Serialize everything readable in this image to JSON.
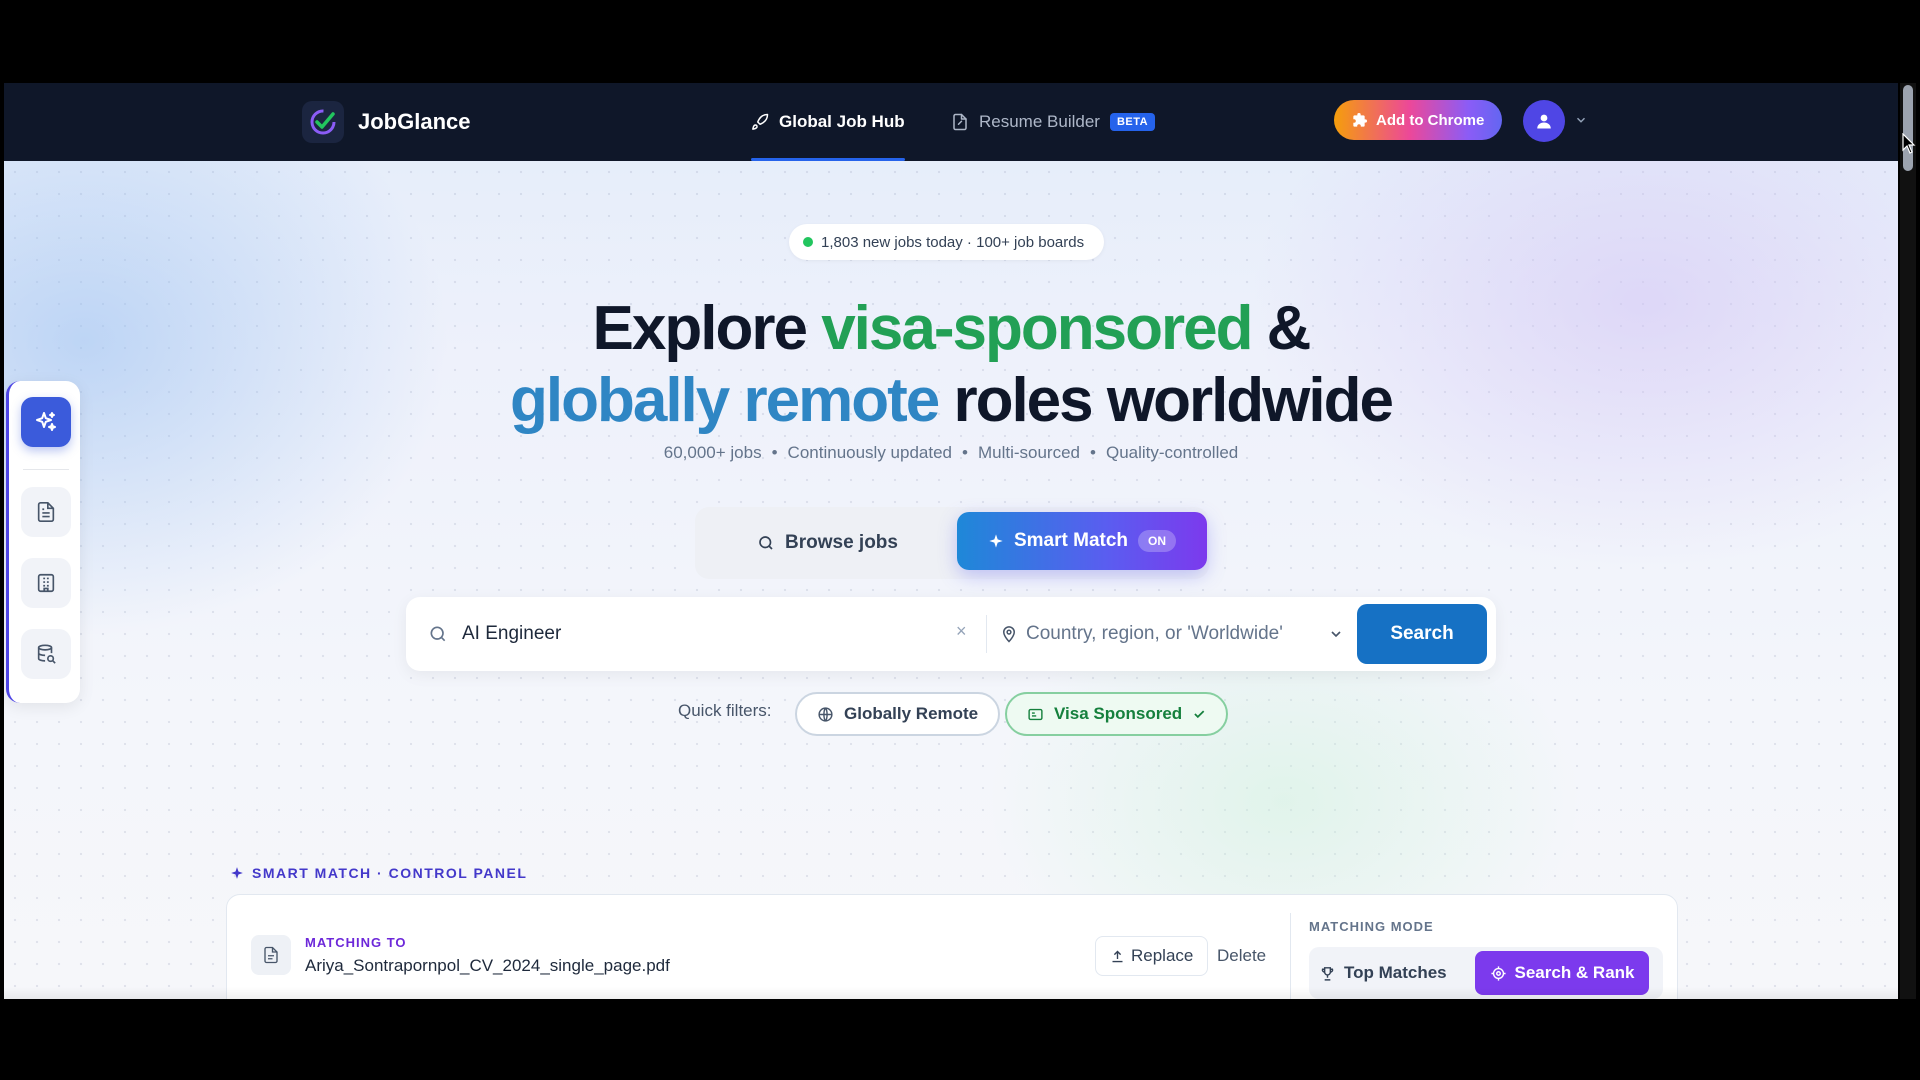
{
  "header": {
    "brand": "JobGlance",
    "tabs": [
      {
        "label": "Global Job Hub",
        "active": true
      },
      {
        "label": "Resume Builder",
        "badge": "BETA",
        "active": false
      }
    ],
    "cta_label": "Add to Chrome"
  },
  "sidebar": {
    "items": [
      {
        "icon": "sparkles-icon",
        "active": true
      },
      {
        "icon": "document-icon"
      },
      {
        "icon": "building-icon"
      },
      {
        "icon": "database-search-icon"
      }
    ]
  },
  "hero": {
    "badge": "1,803 new jobs today · 100+ job boards",
    "headline_line1_a": "Explore ",
    "headline_line1_b": "visa-sponsored",
    "headline_line1_c": " &",
    "headline_line2_a": "globally remote",
    "headline_line2_b": " roles worldwide",
    "subline": [
      "60,000+ jobs",
      "Continuously updated",
      "Multi-sourced",
      "Quality-controlled"
    ],
    "subline_sep": "•"
  },
  "mode_toggle": {
    "browse_label": "Browse jobs",
    "smart_label": "Smart Match",
    "smart_state": "ON"
  },
  "search": {
    "query_value": "AI Engineer",
    "clear_symbol": "×",
    "location_placeholder": "Country, region, or 'Worldwide'",
    "button_label": "Search"
  },
  "quick_filters": {
    "label": "Quick filters:",
    "chips": [
      {
        "label": "Globally Remote",
        "selected": false
      },
      {
        "label": "Visa Sponsored",
        "selected": true
      }
    ]
  },
  "control_panel": {
    "title": "SMART MATCH · CONTROL PANEL",
    "matching_label": "MATCHING TO",
    "file_name": "Ariya_Sontrapornpol_CV_2024_single_page.pdf",
    "replace_label": "Replace",
    "delete_label": "Delete",
    "mode_label": "MATCHING MODE",
    "mode_top": "Top Matches",
    "mode_rank": "Search & Rank",
    "active_mode": "Search & Rank"
  },
  "colors": {
    "nav_bg": "#0f1729",
    "primary_blue": "#1671c4",
    "accent_purple": "#7c3aed",
    "headline_green": "#22a055",
    "headline_blue": "#2f86c4"
  }
}
